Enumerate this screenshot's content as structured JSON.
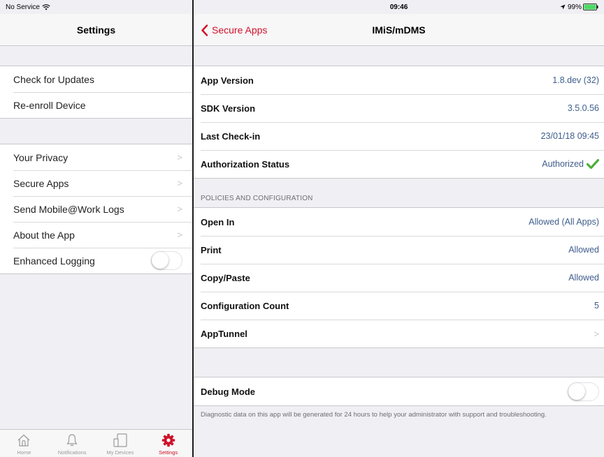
{
  "status": {
    "carrier": "No Service",
    "time": "09:46",
    "battery": "99%"
  },
  "left": {
    "nav_title": "Settings",
    "group1": [
      {
        "label": "Check for Updates"
      },
      {
        "label": "Re-enroll Device"
      }
    ],
    "group2": [
      {
        "label": "Your Privacy"
      },
      {
        "label": "Secure Apps"
      },
      {
        "label": "Send Mobile@Work Logs"
      },
      {
        "label": "About the App"
      }
    ],
    "enhanced_logging": {
      "label": "Enhanced Logging",
      "on": false
    }
  },
  "tabs": [
    {
      "label": "Home",
      "icon": "home-icon",
      "active": false
    },
    {
      "label": "Notifications",
      "icon": "bell-icon",
      "active": false
    },
    {
      "label": "My Devices",
      "icon": "devices-icon",
      "active": false
    },
    {
      "label": "Settings",
      "icon": "gear-icon",
      "active": true
    }
  ],
  "right": {
    "back_label": "Secure Apps",
    "nav_title": "IMiS/mDMS",
    "info": [
      {
        "key": "App Version",
        "value": "1.8.dev (32)"
      },
      {
        "key": "SDK Version",
        "value": "3.5.0.56"
      },
      {
        "key": "Last Check-in",
        "value": "23/01/18 09:45"
      },
      {
        "key": "Authorization Status",
        "value": "Authorized"
      }
    ],
    "policies_header": "POLICIES AND CONFIGURATION",
    "policies": [
      {
        "key": "Open In",
        "value": "Allowed (All Apps)"
      },
      {
        "key": "Print",
        "value": "Allowed"
      },
      {
        "key": "Copy/Paste",
        "value": "Allowed"
      },
      {
        "key": "Configuration Count",
        "value": "5"
      }
    ],
    "apptunnel_label": "AppTunnel",
    "debug": {
      "label": "Debug Mode",
      "on": false
    },
    "debug_note": "Diagnostic data on this app will be generated for 24 hours to help your administrator with support and troubleshooting."
  },
  "colors": {
    "accent": "#d0102a",
    "value_text": "#3f5d8c",
    "check": "#4caf3a",
    "battery": "#4cd964"
  }
}
